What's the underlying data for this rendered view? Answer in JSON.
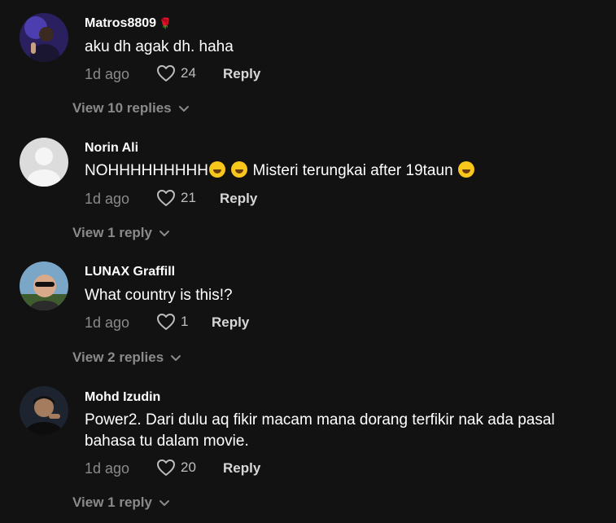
{
  "comments": [
    {
      "username": "Matros8809",
      "flag": "🌹",
      "text": "aku dh agak dh. haha",
      "time": "1d ago",
      "likes": "24",
      "reply_label": "Reply",
      "view_replies": "View 10 replies"
    },
    {
      "username": "Norin Ali",
      "text_parts": [
        "NOHHHHHHHHH",
        " Misteri terungkai after 19taun "
      ],
      "time": "1d ago",
      "likes": "21",
      "reply_label": "Reply",
      "view_replies": "View 1 reply"
    },
    {
      "username": "LUNAX Graffill",
      "text": "What country is this!?",
      "time": "1d ago",
      "likes": "1",
      "reply_label": "Reply",
      "view_replies": "View 2 replies"
    },
    {
      "username": "Mohd Izudin",
      "text": "Power2. Dari dulu aq fikir macam mana dorang terfikir nak ada pasal bahasa tu dalam movie.",
      "time": "1d ago",
      "likes": "20",
      "reply_label": "Reply",
      "view_replies": "View 1 reply"
    }
  ],
  "icons": {
    "like": "heart-outline-icon",
    "expand": "chevron-down-icon",
    "emoji": "rolling-on-floor-laughing-emoji"
  },
  "colors": {
    "background": "#121212",
    "primary_text": "#ffffff",
    "secondary_text": "#8a8a8a"
  }
}
